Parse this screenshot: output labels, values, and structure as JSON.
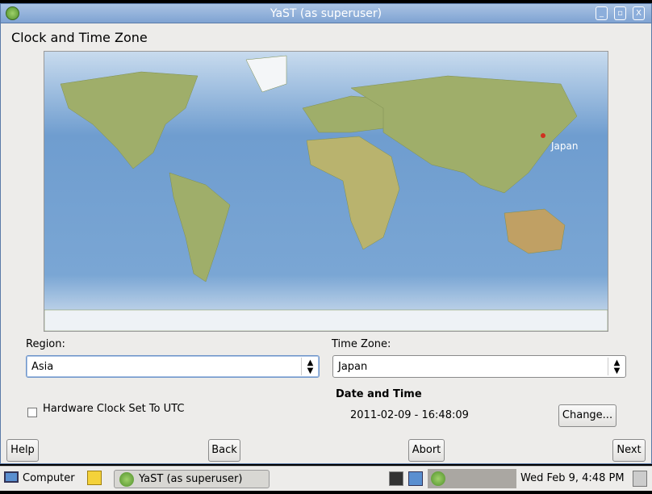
{
  "window": {
    "title": "YaST (as superuser)",
    "controls": [
      "minimize",
      "maximize",
      "close"
    ]
  },
  "page": {
    "heading": "Clock and Time Zone"
  },
  "map": {
    "selected_marker_label": "Japan",
    "marker_color": "#d03020"
  },
  "region": {
    "label": "Region:",
    "value": "Asia"
  },
  "timezone": {
    "label": "Time Zone:",
    "value": "Japan"
  },
  "hardware_clock": {
    "label": "Hardware Clock Set To UTC",
    "checked": false
  },
  "datetime": {
    "heading": "Date and Time",
    "value": "2011-02-09 - 16:48:09",
    "change_label": "Change..."
  },
  "buttons": {
    "help": "Help",
    "back": "Back",
    "abort": "Abort",
    "next": "Next"
  },
  "taskbar": {
    "computer": "Computer",
    "task": "YaST (as superuser)",
    "clock": "Wed Feb  9,  4:48 PM"
  }
}
